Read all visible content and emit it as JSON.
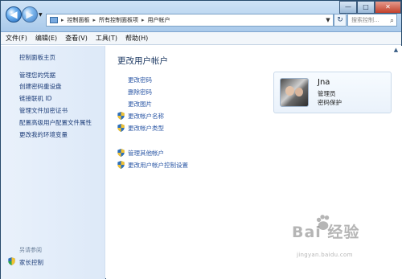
{
  "window": {
    "breadcrumbs": [
      "控制面板",
      "所有控制面板项",
      "用户帐户"
    ],
    "search_placeholder": "搜索控制...",
    "controls": {
      "minimize": "—",
      "maximize": "□",
      "close": "✕"
    }
  },
  "menu": [
    "文件(F)",
    "编辑(E)",
    "查看(V)",
    "工具(T)",
    "帮助(H)"
  ],
  "sidebar": {
    "home": "控制面板主页",
    "links": [
      "管理您的凭据",
      "创建密码重设盘",
      "链接联机 ID",
      "管理文件加密证书",
      "配置高级用户配置文件属性",
      "更改我的环境变量"
    ],
    "see_also_title": "另请参阅",
    "parental": "家长控制"
  },
  "main": {
    "title": "更改用户帐户",
    "tasks": [
      "更改密码",
      "删除密码",
      "更改图片"
    ],
    "shield_tasks": [
      "更改帐户名称",
      "更改帐户类型"
    ],
    "shield_tasks2": [
      "管理其他帐户",
      "更改用户帐户控制设置"
    ]
  },
  "user": {
    "name": "Jna",
    "role": "管理员",
    "password_status": "密码保护"
  },
  "watermark": {
    "main": "Bai 经验",
    "sub": "jingyan.baidu.com"
  },
  "colors": {
    "link": "#2b57a5",
    "title": "#1f3b64",
    "sidebar_bg": "#e3edf9",
    "titlebar_bg": "#bcd6f0"
  }
}
